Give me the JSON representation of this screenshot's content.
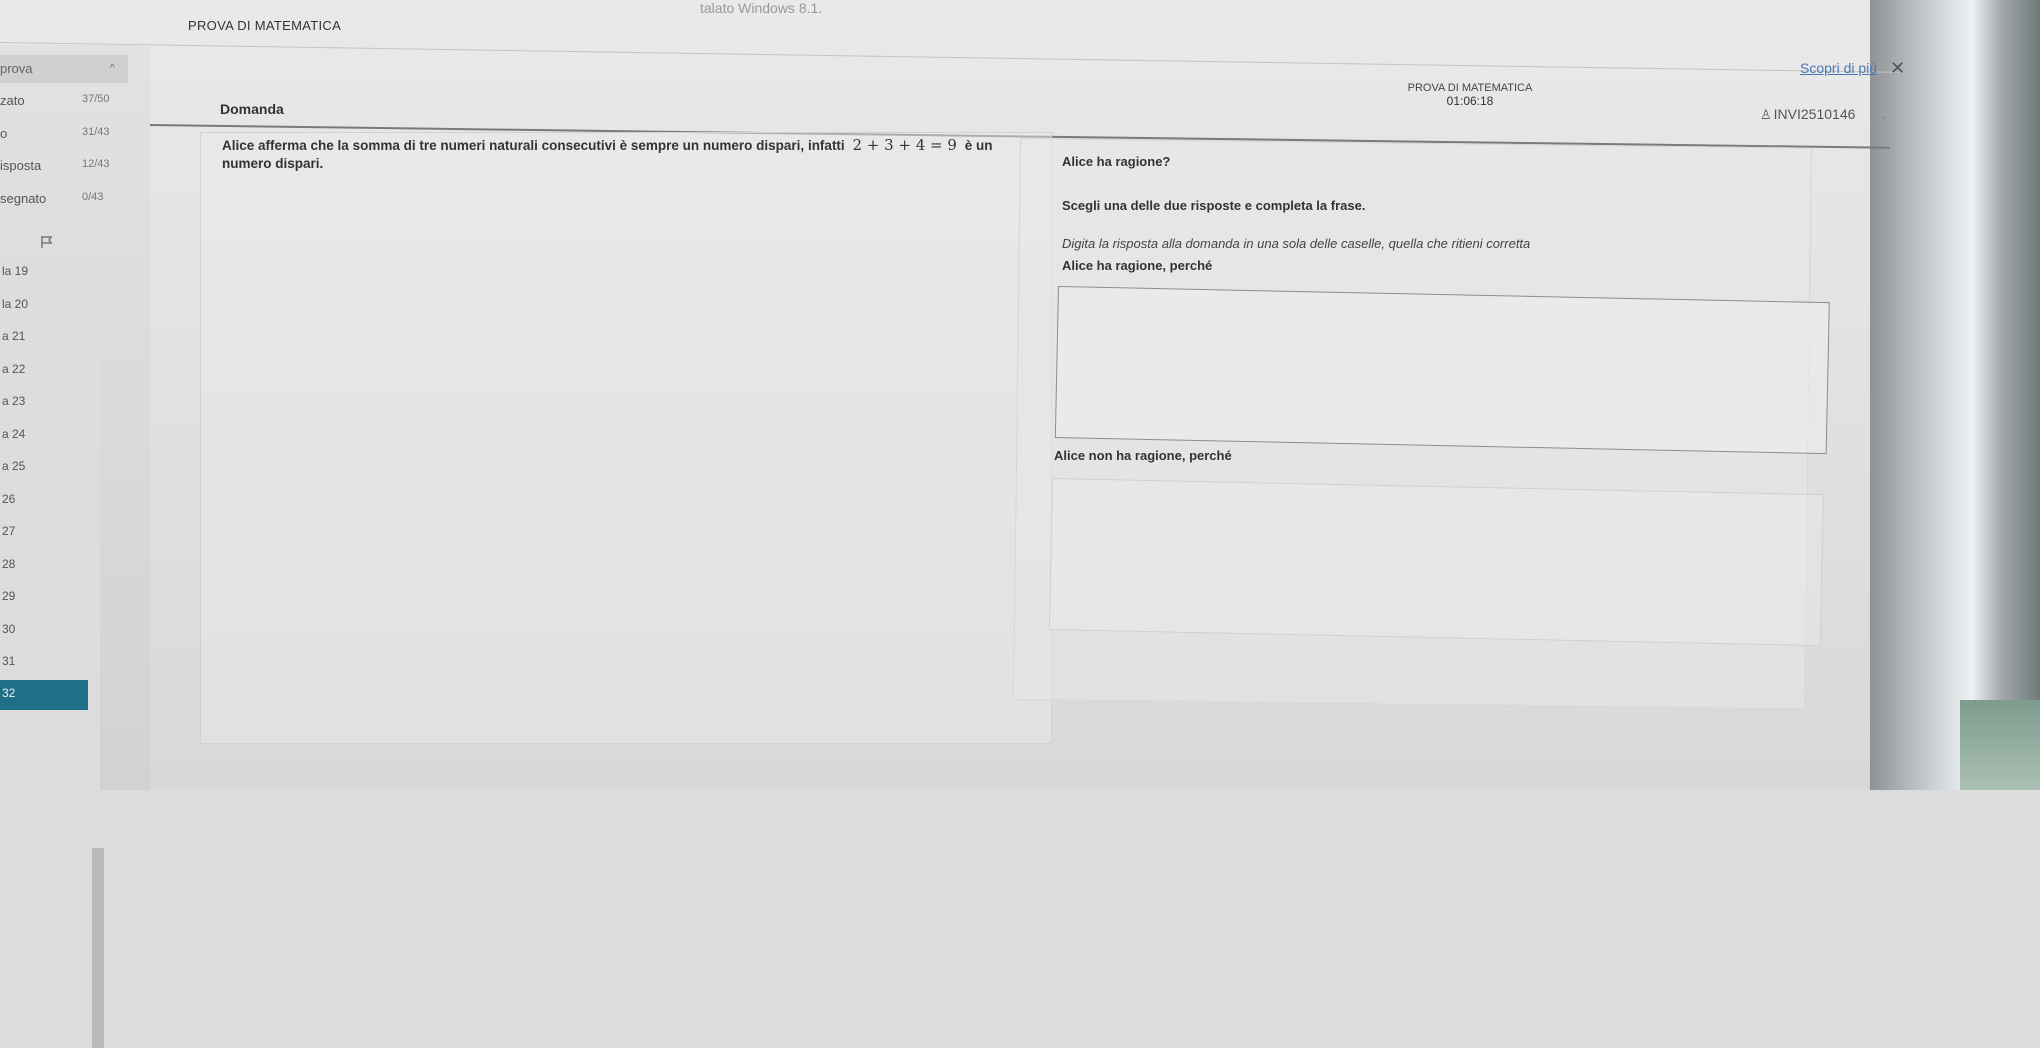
{
  "os_caption": "talato Windows 8.1.",
  "app": {
    "title": "PROVA DI MATEMATICA",
    "learn_more": "Scopri di più",
    "close_icon": "close-icon"
  },
  "sidebar": {
    "header_label": "prova",
    "stats": [
      {
        "label": "zato",
        "value": "37/50"
      },
      {
        "label": "o",
        "value": "31/43"
      },
      {
        "label": "isposta",
        "value": "12/43"
      },
      {
        "label": "segnato",
        "value": "0/43"
      }
    ],
    "questions": [
      "la 19",
      "la 20",
      "a 21",
      "a 22",
      "a 23",
      "a 24",
      "a 25",
      "26",
      "27",
      "28",
      "29",
      "30",
      "31",
      "32"
    ],
    "active_question": "32"
  },
  "header": {
    "exam_title": "PROVA DI MATEMATICA",
    "timer": "01:06:18",
    "user_id": "INVI2510146"
  },
  "question": {
    "heading": "Domanda",
    "text_before": "Alice afferma che la somma di tre numeri naturali consecutivi è sempre un numero dispari, infatti",
    "math": "2 + 3 + 4 = 9",
    "text_after": "è un numero dispari."
  },
  "answer": {
    "question": "Alice ha ragione?",
    "instruction": "Scegli una delle due risposte e completa la frase.",
    "hint": "Digita la risposta alla domanda in una sola delle caselle, quella che ritieni corretta",
    "option1_label": "Alice ha ragione, perché",
    "option1_value": "",
    "option2_label": "Alice non ha ragione, perché",
    "option2_value": ""
  },
  "colors": {
    "accent": "#1f6f88",
    "link": "#4a78b8"
  }
}
